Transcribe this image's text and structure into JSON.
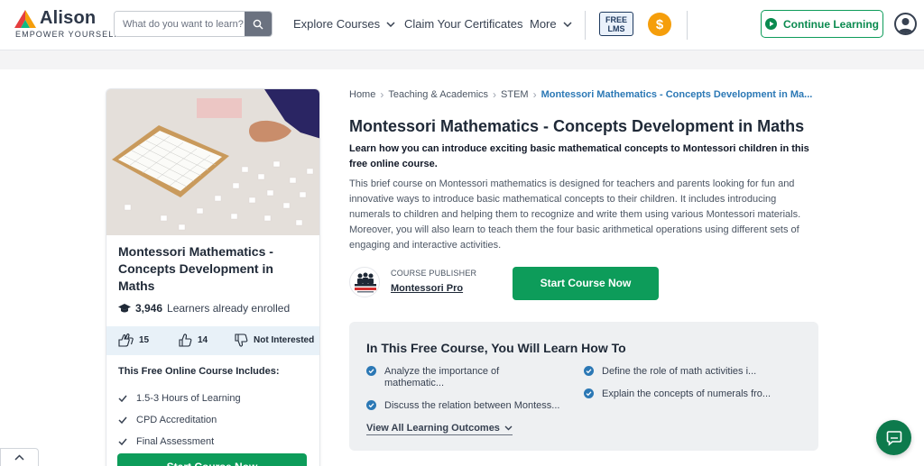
{
  "header": {
    "logo_word": "Alison",
    "logo_tagline": "EMPOWER YOURSELF",
    "search_placeholder": "What do you want to learn?",
    "nav_explore": "Explore Courses",
    "nav_certificates": "Claim Your Certificates",
    "nav_more": "More",
    "free_lms_line1": "FREE",
    "free_lms_line2": "LMS",
    "coin_symbol": "$",
    "continue_label": "Continue Learning"
  },
  "card": {
    "title": "Montessori Mathematics - Concepts Development in Maths",
    "learners_count": "3,946",
    "learners_text": "Learners already enrolled",
    "likes": "15",
    "thumbs": "14",
    "not_interested": "Not Interested",
    "includes_title": "This Free Online Course Includes:",
    "includes": [
      "1.5-3 Hours of Learning",
      "CPD Accreditation",
      "Final Assessment"
    ],
    "cta": "Start Course Now"
  },
  "breadcrumb": [
    "Home",
    "Teaching & Academics",
    "STEM",
    "Montessori Mathematics - Concepts Development in Ma..."
  ],
  "course": {
    "title": "Montessori Mathematics - Concepts Development in Maths",
    "lead": "Learn how you can introduce exciting basic mathematical concepts to Montessori children in this free online course.",
    "description": "This brief course on Montessori mathematics is designed for teachers and parents looking for fun and innovative ways to introduce basic mathematical concepts to their children. It includes introducing numerals to children and helping them to recognize and write them using various Montessori materials. Moreover, you will also learn to teach them the four basic arithmetical operations using different sets of engaging and interactive activities."
  },
  "publisher": {
    "label": "COURSE PUBLISHER",
    "name": "Montessori Pro"
  },
  "start_button": "Start Course Now",
  "learn": {
    "title": "In This Free Course, You Will Learn How To",
    "outcomes": [
      "Analyze the importance of mathematic...",
      "Define the role of math activities i...",
      "Discuss the relation between Montess...",
      "Explain the concepts of numerals fro..."
    ],
    "view_all": "View All Learning Outcomes"
  },
  "colors": {
    "brand_green": "#0d9c5a",
    "link_blue": "#2b78b5",
    "coin_orange": "#f59e0b"
  },
  "icons": [
    "search-icon",
    "chevron-down-icon",
    "play-circle-icon",
    "user-avatar-icon",
    "graduation-cap-icon",
    "clap-icon",
    "thumbs-up-icon",
    "thumbs-down-icon",
    "check-icon",
    "check-circle-icon",
    "chat-icon",
    "chevron-up-icon"
  ]
}
